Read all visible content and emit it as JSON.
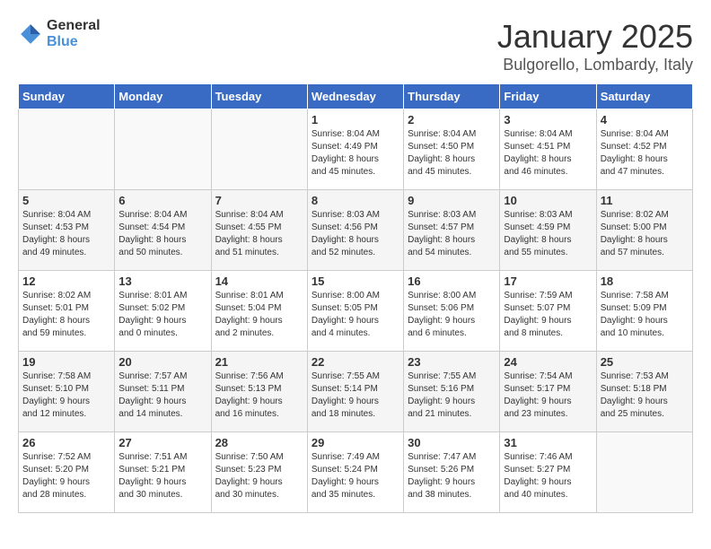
{
  "header": {
    "logo_general": "General",
    "logo_blue": "Blue",
    "month_title": "January 2025",
    "location": "Bulgorello, Lombardy, Italy"
  },
  "days_of_week": [
    "Sunday",
    "Monday",
    "Tuesday",
    "Wednesday",
    "Thursday",
    "Friday",
    "Saturday"
  ],
  "weeks": [
    [
      {
        "day": "",
        "info": ""
      },
      {
        "day": "",
        "info": ""
      },
      {
        "day": "",
        "info": ""
      },
      {
        "day": "1",
        "info": "Sunrise: 8:04 AM\nSunset: 4:49 PM\nDaylight: 8 hours\nand 45 minutes."
      },
      {
        "day": "2",
        "info": "Sunrise: 8:04 AM\nSunset: 4:50 PM\nDaylight: 8 hours\nand 45 minutes."
      },
      {
        "day": "3",
        "info": "Sunrise: 8:04 AM\nSunset: 4:51 PM\nDaylight: 8 hours\nand 46 minutes."
      },
      {
        "day": "4",
        "info": "Sunrise: 8:04 AM\nSunset: 4:52 PM\nDaylight: 8 hours\nand 47 minutes."
      }
    ],
    [
      {
        "day": "5",
        "info": "Sunrise: 8:04 AM\nSunset: 4:53 PM\nDaylight: 8 hours\nand 49 minutes."
      },
      {
        "day": "6",
        "info": "Sunrise: 8:04 AM\nSunset: 4:54 PM\nDaylight: 8 hours\nand 50 minutes."
      },
      {
        "day": "7",
        "info": "Sunrise: 8:04 AM\nSunset: 4:55 PM\nDaylight: 8 hours\nand 51 minutes."
      },
      {
        "day": "8",
        "info": "Sunrise: 8:03 AM\nSunset: 4:56 PM\nDaylight: 8 hours\nand 52 minutes."
      },
      {
        "day": "9",
        "info": "Sunrise: 8:03 AM\nSunset: 4:57 PM\nDaylight: 8 hours\nand 54 minutes."
      },
      {
        "day": "10",
        "info": "Sunrise: 8:03 AM\nSunset: 4:59 PM\nDaylight: 8 hours\nand 55 minutes."
      },
      {
        "day": "11",
        "info": "Sunrise: 8:02 AM\nSunset: 5:00 PM\nDaylight: 8 hours\nand 57 minutes."
      }
    ],
    [
      {
        "day": "12",
        "info": "Sunrise: 8:02 AM\nSunset: 5:01 PM\nDaylight: 8 hours\nand 59 minutes."
      },
      {
        "day": "13",
        "info": "Sunrise: 8:01 AM\nSunset: 5:02 PM\nDaylight: 9 hours\nand 0 minutes."
      },
      {
        "day": "14",
        "info": "Sunrise: 8:01 AM\nSunset: 5:04 PM\nDaylight: 9 hours\nand 2 minutes."
      },
      {
        "day": "15",
        "info": "Sunrise: 8:00 AM\nSunset: 5:05 PM\nDaylight: 9 hours\nand 4 minutes."
      },
      {
        "day": "16",
        "info": "Sunrise: 8:00 AM\nSunset: 5:06 PM\nDaylight: 9 hours\nand 6 minutes."
      },
      {
        "day": "17",
        "info": "Sunrise: 7:59 AM\nSunset: 5:07 PM\nDaylight: 9 hours\nand 8 minutes."
      },
      {
        "day": "18",
        "info": "Sunrise: 7:58 AM\nSunset: 5:09 PM\nDaylight: 9 hours\nand 10 minutes."
      }
    ],
    [
      {
        "day": "19",
        "info": "Sunrise: 7:58 AM\nSunset: 5:10 PM\nDaylight: 9 hours\nand 12 minutes."
      },
      {
        "day": "20",
        "info": "Sunrise: 7:57 AM\nSunset: 5:11 PM\nDaylight: 9 hours\nand 14 minutes."
      },
      {
        "day": "21",
        "info": "Sunrise: 7:56 AM\nSunset: 5:13 PM\nDaylight: 9 hours\nand 16 minutes."
      },
      {
        "day": "22",
        "info": "Sunrise: 7:55 AM\nSunset: 5:14 PM\nDaylight: 9 hours\nand 18 minutes."
      },
      {
        "day": "23",
        "info": "Sunrise: 7:55 AM\nSunset: 5:16 PM\nDaylight: 9 hours\nand 21 minutes."
      },
      {
        "day": "24",
        "info": "Sunrise: 7:54 AM\nSunset: 5:17 PM\nDaylight: 9 hours\nand 23 minutes."
      },
      {
        "day": "25",
        "info": "Sunrise: 7:53 AM\nSunset: 5:18 PM\nDaylight: 9 hours\nand 25 minutes."
      }
    ],
    [
      {
        "day": "26",
        "info": "Sunrise: 7:52 AM\nSunset: 5:20 PM\nDaylight: 9 hours\nand 28 minutes."
      },
      {
        "day": "27",
        "info": "Sunrise: 7:51 AM\nSunset: 5:21 PM\nDaylight: 9 hours\nand 30 minutes."
      },
      {
        "day": "28",
        "info": "Sunrise: 7:50 AM\nSunset: 5:23 PM\nDaylight: 9 hours\nand 30 minutes."
      },
      {
        "day": "29",
        "info": "Sunrise: 7:49 AM\nSunset: 5:24 PM\nDaylight: 9 hours\nand 35 minutes."
      },
      {
        "day": "30",
        "info": "Sunrise: 7:47 AM\nSunset: 5:26 PM\nDaylight: 9 hours\nand 38 minutes."
      },
      {
        "day": "31",
        "info": "Sunrise: 7:46 AM\nSunset: 5:27 PM\nDaylight: 9 hours\nand 40 minutes."
      },
      {
        "day": "",
        "info": ""
      }
    ]
  ]
}
